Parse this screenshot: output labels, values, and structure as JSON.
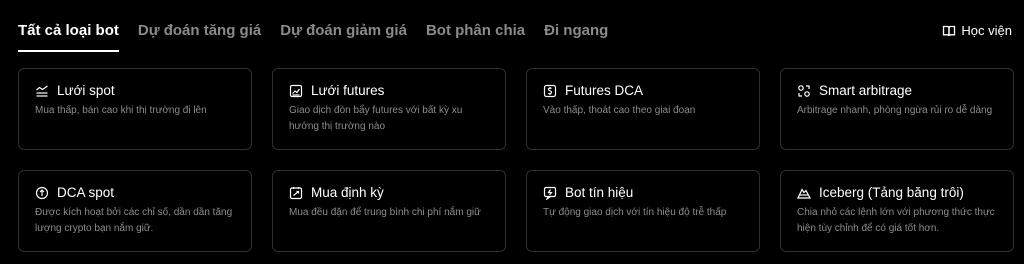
{
  "tabs": [
    {
      "label": "Tất cả loại bot",
      "active": true
    },
    {
      "label": "Dự đoán tăng giá",
      "active": false
    },
    {
      "label": "Dự đoán giảm giá",
      "active": false
    },
    {
      "label": "Bot phân chia",
      "active": false
    },
    {
      "label": "Đi ngang",
      "active": false
    }
  ],
  "academy": {
    "label": "Học viện",
    "icon": "book-icon"
  },
  "cards": [
    {
      "title": "Lưới spot",
      "desc": "Mua thấp, bán cao khi thị trường đi lên",
      "icon": "grid-line-icon"
    },
    {
      "title": "Lưới futures",
      "desc": "Giao dịch đòn bẩy futures với bất kỳ xu hướng thị trường nào",
      "icon": "futures-chart-icon"
    },
    {
      "title": "Futures DCA",
      "desc": "Vào thấp, thoát cao theo giai đoạn",
      "icon": "futures-dca-icon"
    },
    {
      "title": "Smart arbitrage",
      "desc": "Arbitrage nhanh, phòng ngừa rủi ro dễ dàng",
      "icon": "arbitrage-icon"
    },
    {
      "title": "DCA spot",
      "desc": "Được kích hoạt bởi các chỉ số, dần dần tăng lượng crypto bạn nắm giữ.",
      "icon": "dca-coin-icon"
    },
    {
      "title": "Mua định kỳ",
      "desc": "Mua đều đặn để trung bình chi phí nắm giữ",
      "icon": "recurring-buy-icon"
    },
    {
      "title": "Bot tín hiệu",
      "desc": "Tự động giao dịch với tín hiệu độ trễ thấp",
      "icon": "signal-icon"
    },
    {
      "title": "Iceberg (Tảng băng trôi)",
      "desc": "Chia nhỏ các lệnh lớn với phương thức thực hiện tùy chỉnh để có giá tốt hơn.",
      "icon": "iceberg-icon"
    }
  ]
}
